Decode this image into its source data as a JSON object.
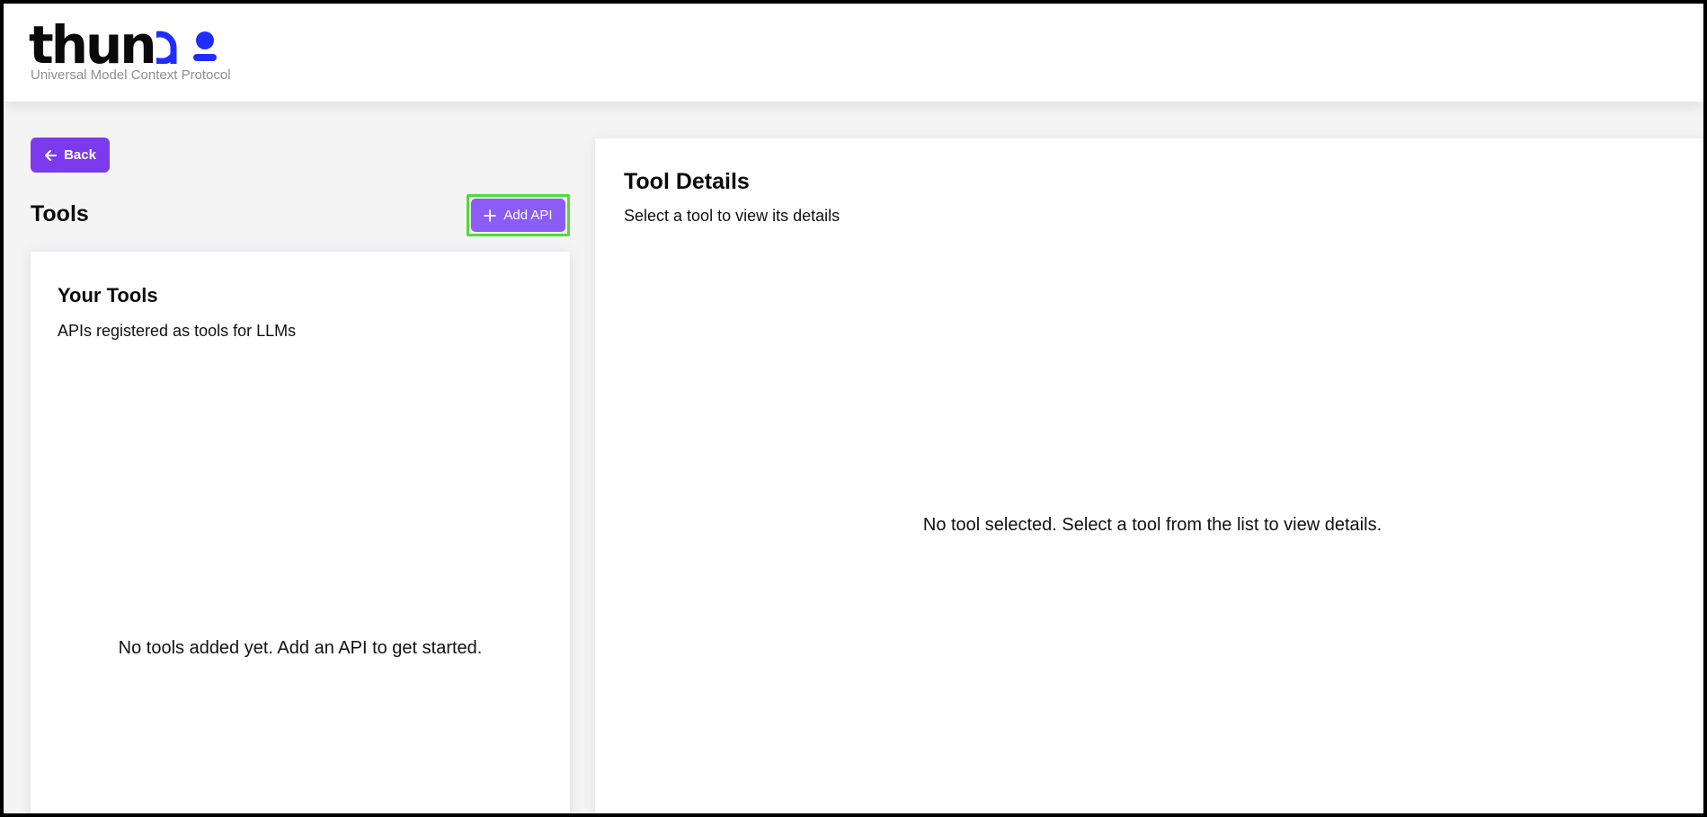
{
  "header": {
    "logo_text": "thun",
    "tagline": "Universal Model Context Protocol"
  },
  "colors": {
    "accent_purple": "#7c3aed",
    "button_purple_light": "#8b5cf6",
    "logo_blue": "#1f2eff",
    "highlight_green": "#4ade38"
  },
  "nav": {
    "back_label": "Back",
    "back_icon": "arrow-left-icon"
  },
  "tools_panel": {
    "title": "Tools",
    "add_api_label": "Add API",
    "add_api_icon": "plus-icon",
    "card": {
      "title": "Your Tools",
      "subtitle": "APIs registered as tools for LLMs",
      "empty_message": "No tools added yet. Add an API to get started."
    }
  },
  "details_panel": {
    "title": "Tool Details",
    "subtitle": "Select a tool to view its details",
    "empty_message": "No tool selected. Select a tool from the list to view details."
  }
}
